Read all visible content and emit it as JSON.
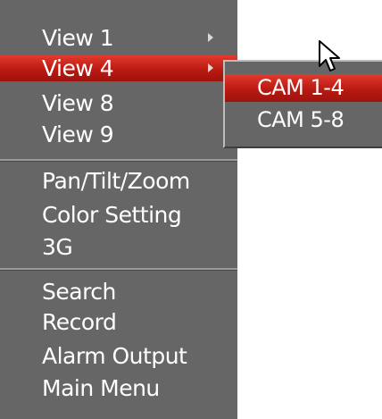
{
  "menu": {
    "items": [
      {
        "label": "View 1",
        "has_submenu": true,
        "active": false
      },
      {
        "label": "View 4",
        "has_submenu": true,
        "active": true
      },
      {
        "label": "View 8",
        "has_submenu": false,
        "active": false
      },
      {
        "label": "View 9",
        "has_submenu": false,
        "active": false
      },
      {
        "label": "Pan/Tilt/Zoom"
      },
      {
        "label": "Color Setting"
      },
      {
        "label": "3G"
      },
      {
        "label": "Search"
      },
      {
        "label": "Record"
      },
      {
        "label": "Alarm Output"
      },
      {
        "label": "Main Menu"
      }
    ]
  },
  "submenu": {
    "items": [
      {
        "label": "CAM 1-4",
        "active": true
      },
      {
        "label": "CAM 5-8",
        "active": false
      }
    ]
  },
  "colors": {
    "menu_bg": "#666666",
    "highlight": "#c8231a",
    "text": "#ffffff"
  },
  "icons": {
    "submenu_arrow": "triangle-right-icon",
    "cursor": "mouse-pointer-icon"
  }
}
